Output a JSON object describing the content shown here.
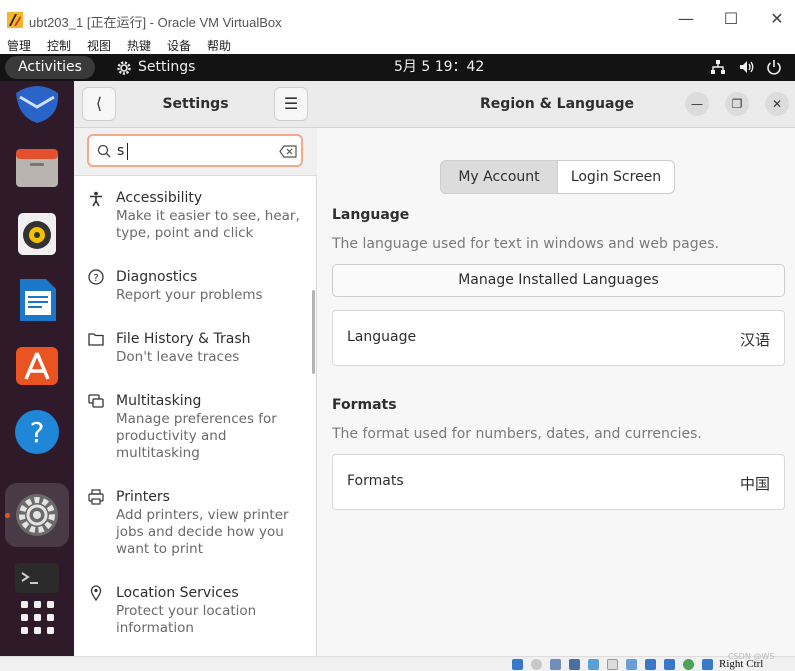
{
  "host_window": {
    "title": "ubt203_1 [正在运行] - Oracle VM VirtualBox",
    "menu": [
      "管理",
      "控制",
      "视图",
      "热键",
      "设备",
      "帮助"
    ]
  },
  "topbar": {
    "activities": "Activities",
    "app_name": "Settings",
    "clock": "5月 5  19：42"
  },
  "dock": {
    "items": [
      "thunderbird-icon",
      "files-icon",
      "rhythmbox-icon",
      "libreoffice-writer-icon",
      "software-icon",
      "help-icon",
      "settings-icon",
      "terminal-icon",
      "show-apps-icon"
    ]
  },
  "settings": {
    "title": "Settings",
    "search_value": "s",
    "results": [
      {
        "title": "Accessibility",
        "desc": "Make it easier to see, hear, type, point and click"
      },
      {
        "title": "Diagnostics",
        "desc": "Report your problems"
      },
      {
        "title": "File History & Trash",
        "desc": "Don't leave traces"
      },
      {
        "title": "Multitasking",
        "desc": "Manage preferences for productivity and multitasking"
      },
      {
        "title": "Printers",
        "desc": "Add printers, view printer jobs and decide how you want to print"
      },
      {
        "title": "Location Services",
        "desc": "Protect your location information"
      }
    ]
  },
  "region": {
    "title": "Region & Language",
    "tabs": [
      "My Account",
      "Login Screen"
    ],
    "language_section": {
      "title": "Language",
      "desc": "The language used for text in windows and web pages.",
      "manage_button": "Manage Installed Languages",
      "row_label": "Language",
      "row_value": "汉语"
    },
    "formats_section": {
      "title": "Formats",
      "desc": "The format used for numbers, dates, and currencies.",
      "row_label": "Formats",
      "row_value": "中国"
    }
  },
  "statusbar": {
    "host_key": "Right Ctrl"
  },
  "watermark": "CSDN @WS"
}
